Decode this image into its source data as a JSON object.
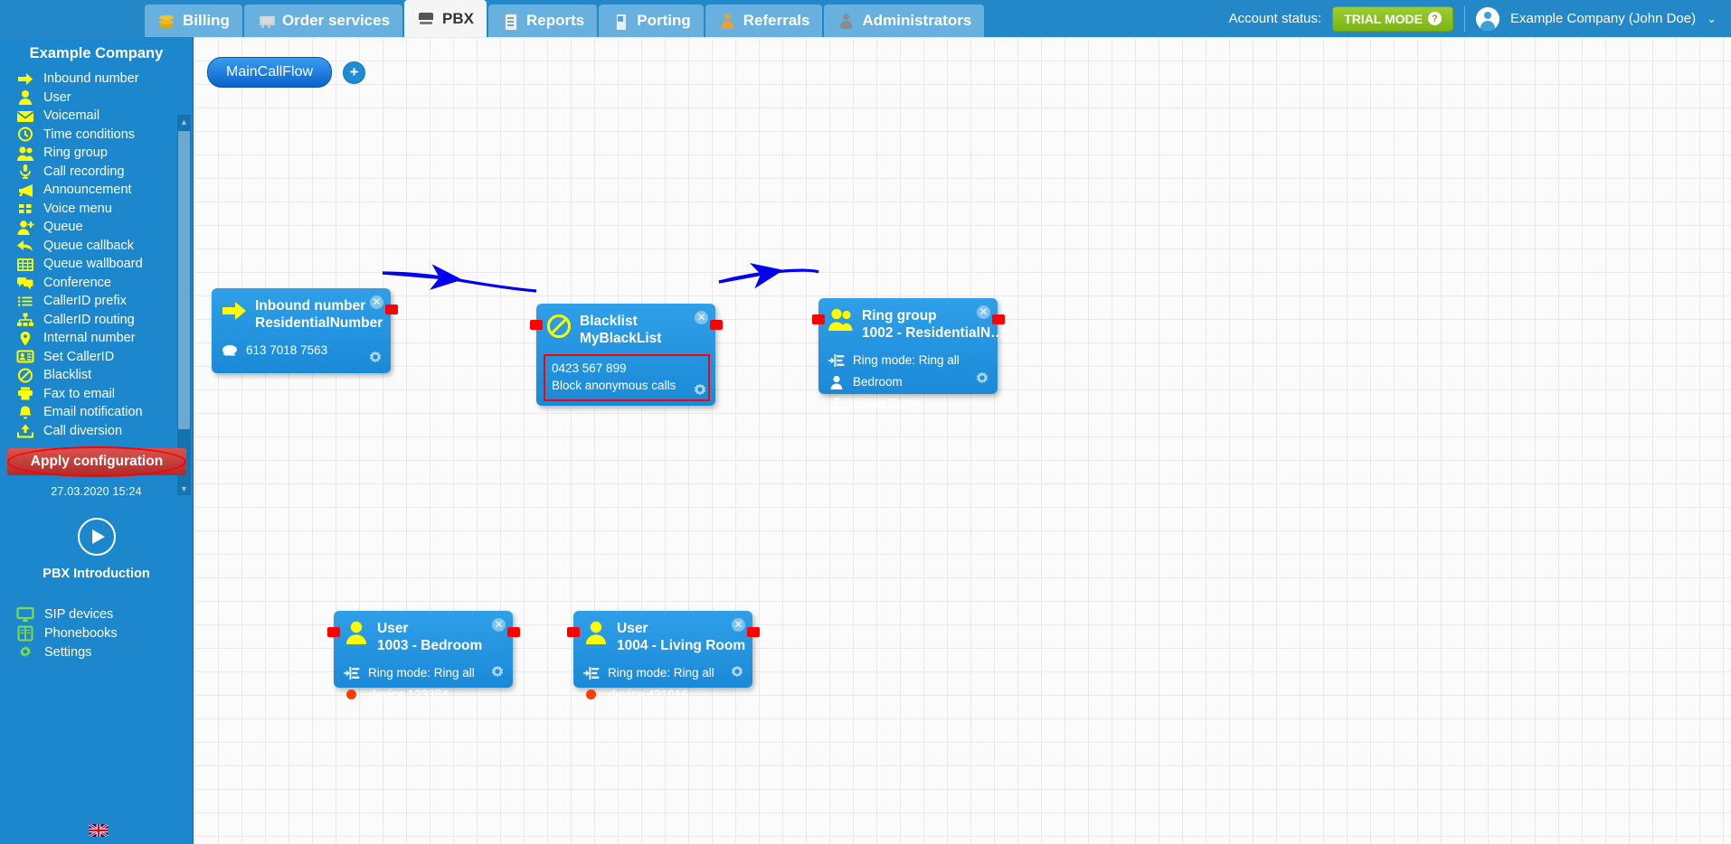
{
  "topbar": {
    "tabs": [
      {
        "label": "Billing",
        "icon": "coins-icon",
        "active": false
      },
      {
        "label": "Order services",
        "icon": "shopping-cart-icon",
        "active": false
      },
      {
        "label": "PBX",
        "icon": "pbx-switchboard-icon",
        "active": true
      },
      {
        "label": "Reports",
        "icon": "report-document-icon",
        "active": false
      },
      {
        "label": "Porting",
        "icon": "mobile-phone-icon",
        "active": false
      },
      {
        "label": "Referrals",
        "icon": "person-icon",
        "active": false
      },
      {
        "label": "Administrators",
        "icon": "person-icon",
        "active": false
      }
    ],
    "account_status_label": "Account status:",
    "trial_badge": "TRIAL MODE",
    "trial_help": "?",
    "user_name": "Example Company (John Doe)",
    "user_caret": "⌄",
    "accent_blue": "#2387c8",
    "trial_green": "#8fc320"
  },
  "sidebar": {
    "company": "Example Company",
    "items": [
      {
        "label": "Inbound number",
        "icon": "arrow-right-icon"
      },
      {
        "label": "User",
        "icon": "user-icon"
      },
      {
        "label": "Voicemail",
        "icon": "envelope-icon"
      },
      {
        "label": "Time conditions",
        "icon": "clock-icon"
      },
      {
        "label": "Ring group",
        "icon": "users-group-icon"
      },
      {
        "label": "Call recording",
        "icon": "microphone-icon"
      },
      {
        "label": "Announcement",
        "icon": "megaphone-icon"
      },
      {
        "label": "Voice menu",
        "icon": "grid-squares-icon"
      },
      {
        "label": "Queue",
        "icon": "user-plus-icon"
      },
      {
        "label": "Queue callback",
        "icon": "arrow-back-icon"
      },
      {
        "label": "Queue wallboard",
        "icon": "table-grid-icon"
      },
      {
        "label": "Conference",
        "icon": "chat-bubbles-icon"
      },
      {
        "label": "CallerID prefix",
        "icon": "list-icon"
      },
      {
        "label": "CallerID routing",
        "icon": "sitemap-icon"
      },
      {
        "label": "Internal number",
        "icon": "map-pin-icon"
      },
      {
        "label": "Set CallerID",
        "icon": "id-card-icon"
      },
      {
        "label": "Blacklist",
        "icon": "block-circle-icon"
      },
      {
        "label": "Fax to email",
        "icon": "printer-icon"
      },
      {
        "label": "Email notification",
        "icon": "bell-icon"
      },
      {
        "label": "Call diversion",
        "icon": "upload-arrow-icon"
      }
    ],
    "apply_button": "Apply configuration",
    "config_time": "27.03.2020 15:24",
    "intro_label": "PBX Introduction",
    "bottom_items": [
      {
        "label": "SIP devices",
        "icon": "monitor-icon"
      },
      {
        "label": "Phonebooks",
        "icon": "book-icon"
      },
      {
        "label": "Settings",
        "icon": "gear-icon"
      }
    ],
    "language_flag": "uk-flag-icon",
    "scroll_up": "▲",
    "scroll_down": "▼"
  },
  "canvas": {
    "flow_tab": "MainCallFlow",
    "add_flow_button": "+",
    "nodes": [
      {
        "id": "inbound",
        "type": "Inbound number",
        "name": "ResidentialNumber",
        "icon": "arrow-right-icon",
        "rows": [
          {
            "icon": "telephone-icon",
            "text": "613 7018 7563"
          }
        ],
        "close": "✕",
        "gear": "gear-icon"
      },
      {
        "id": "blacklist",
        "type": "Blacklist",
        "name": "MyBlackList",
        "icon": "block-circle-icon",
        "highlighted_lines": [
          "0423 567 899",
          "Block anonymous calls"
        ],
        "close": "✕",
        "gear": "gear-icon"
      },
      {
        "id": "ringgroup",
        "type": "Ring group",
        "name": "1002 - ResidentialN…",
        "icon": "users-group-icon",
        "rows": [
          {
            "icon": "ring-mode-icon",
            "text": "Ring mode: Ring all"
          },
          {
            "icon": "user-icon",
            "text": "Bedroom"
          },
          {
            "icon": "user-icon",
            "text": "Living Room"
          }
        ],
        "close": "✕",
        "gear": "gear-icon"
      },
      {
        "id": "user1003",
        "type": "User",
        "name": "1003 - Bedroom",
        "icon": "user-icon",
        "rows": [
          {
            "icon": "ring-mode-icon",
            "text": "Ring mode: Ring all"
          },
          {
            "icon": "red-dot-icon",
            "text": "device 123354"
          }
        ],
        "close": "✕",
        "gear": "gear-icon"
      },
      {
        "id": "user1004",
        "type": "User",
        "name": "1004 - Living Room",
        "icon": "user-icon",
        "rows": [
          {
            "icon": "ring-mode-icon",
            "text": "Ring mode: Ring all"
          },
          {
            "icon": "red-dot-icon",
            "text": "device 431016"
          }
        ],
        "close": "✕",
        "gear": "gear-icon"
      }
    ],
    "edge_color": "#0000ee",
    "port_color": "#ff0000",
    "node_color": "#1f90dd"
  }
}
